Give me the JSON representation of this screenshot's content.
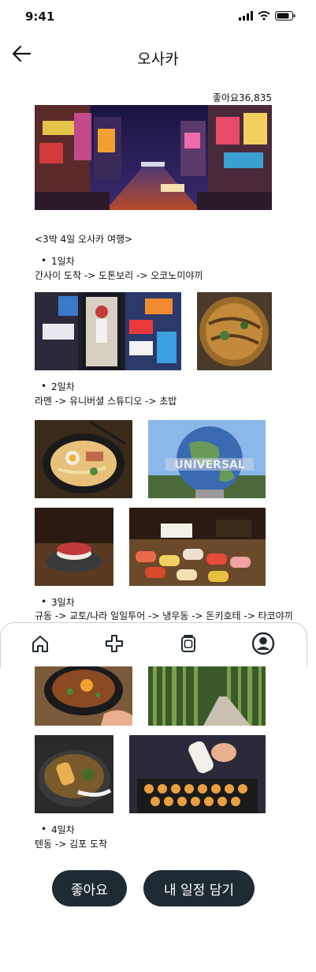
{
  "status_bar": {
    "time": "9:41"
  },
  "header": {
    "title": "오사카"
  },
  "post": {
    "likes": "좋아요36,835",
    "heading": "<3박 4일 오사카 여행>",
    "days": [
      {
        "label": "1일차",
        "route": "간사이 도착 -> 도톤보리 -> 오코노미야끼"
      },
      {
        "label": "2일차",
        "route": "라멘 -> 유니버셜 스튜디오 -> 초밥"
      },
      {
        "label": "3일차",
        "route": "규동 -> 교토/나라 일일투어 -> 냉우동 -> 돈키호테 -> 타코야끼"
      },
      {
        "label": "4일차",
        "route": "텐동 -> 김포 도착"
      }
    ]
  },
  "bullet_char": "•",
  "tab_bar": {
    "tabs": [
      "home-icon",
      "plus-icon",
      "gallery-icon",
      "profile-icon"
    ]
  },
  "actions": {
    "like_label": "좋아요",
    "save_label": "내 일정 담기"
  },
  "colors": {
    "button_bg": "#1f2b32",
    "button_text": "#ffffff",
    "tabbar_border": "#cfcfcf"
  }
}
